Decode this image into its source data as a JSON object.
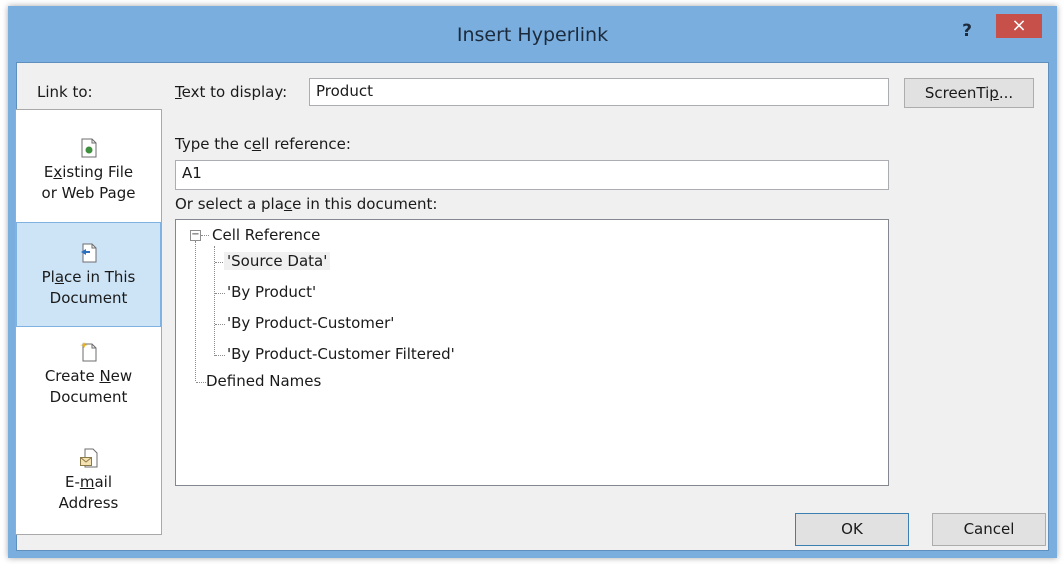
{
  "window": {
    "title": "Insert Hyperlink",
    "help": "?",
    "close": "×"
  },
  "link_to": {
    "label": "Link to:",
    "items": [
      {
        "pre": "E",
        "u": "x",
        "post": "isting File",
        "line2": "or Web Page",
        "icon": "existing-file-icon",
        "selected": false
      },
      {
        "pre": "Pl",
        "u": "a",
        "post": "ce in This",
        "line2": "Document",
        "icon": "place-in-document-icon",
        "selected": true
      },
      {
        "pre": "Create ",
        "u": "N",
        "post": "ew",
        "line2": "Document",
        "icon": "new-document-icon",
        "selected": false
      },
      {
        "pre": "E-",
        "u": "m",
        "post": "ail",
        "line2": "Address",
        "icon": "email-address-icon",
        "selected": false
      }
    ]
  },
  "text_display": {
    "label_u": "T",
    "label_rest": "ext to display:",
    "value": "Product"
  },
  "screentip": {
    "pre": "ScreenTi",
    "u": "p",
    "post": "..."
  },
  "cell_ref": {
    "label_pre": "Type the c",
    "label_u": "e",
    "label_post": "ll reference:",
    "value": "A1"
  },
  "place": {
    "label_pre": "Or select a pla",
    "label_u": "c",
    "label_post": "e in this document:",
    "tree": {
      "root": "Cell Reference",
      "expander": "−",
      "children": [
        "'Source Data'",
        "'By Product'",
        "'By Product-Customer'",
        "'By Product-Customer Filtered'"
      ],
      "selected_index": 0,
      "defined": "Defined Names"
    }
  },
  "buttons": {
    "ok": "OK",
    "cancel": "Cancel"
  },
  "colors": {
    "frame": "#79aede",
    "close": "#c7504b",
    "selected_link": "#cde4f7"
  }
}
